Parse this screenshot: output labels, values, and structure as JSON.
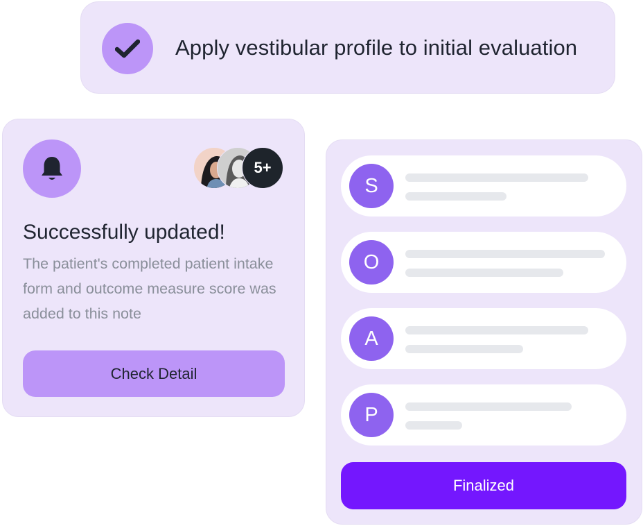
{
  "colors": {
    "card_bg": "#ede5fa",
    "accent_light": "#bc95f8",
    "accent_dark": "#7417fe",
    "letter_bg": "#8e63ef",
    "text_dark": "#1f2430",
    "text_muted": "#8a8f9a"
  },
  "banner": {
    "icon": "checkmark-icon",
    "title": "Apply vestibular profile to initial evaluation"
  },
  "notification": {
    "icon": "bell-icon",
    "avatars_more_label": "5+",
    "heading": "Successfully updated!",
    "description": "The patient's completed patient intake form and outcome measure score was added to this note",
    "button_label": "Check Detail"
  },
  "soap": {
    "items": [
      {
        "letter": "S"
      },
      {
        "letter": "O"
      },
      {
        "letter": "A"
      },
      {
        "letter": "P"
      }
    ],
    "button_label": "Finalized"
  }
}
